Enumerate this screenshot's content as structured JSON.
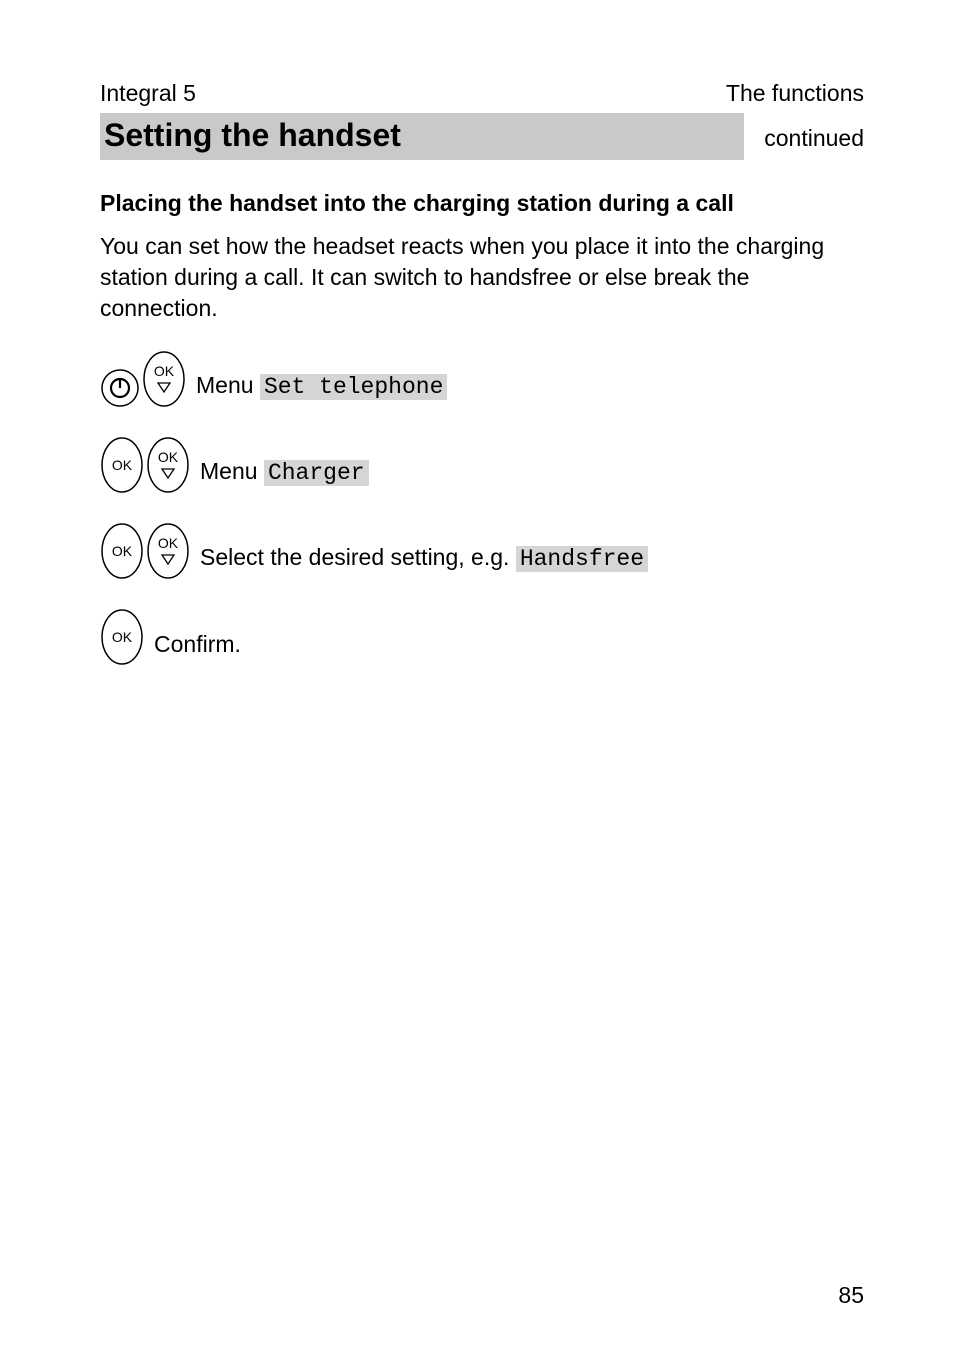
{
  "header": {
    "left": "Integral 5",
    "right": "The functions"
  },
  "titlebar": {
    "title": "Setting the handset",
    "continued": "continued"
  },
  "subhead": "Placing the handset into the charging station during a call",
  "intro": "You can set how the headset reacts when you place it into the charging station during a call. It can switch to handsfree or else break the connection.",
  "steps": {
    "s1_menu_word": "Menu",
    "s1_menu_item": "Set telephone",
    "s2_menu_word": "Menu",
    "s2_menu_item": "Charger",
    "s3_text_a": "Select the desired setting, e.g.",
    "s3_menu_item": "Handsfree",
    "s4_text": "Confirm."
  },
  "page_number": "85"
}
